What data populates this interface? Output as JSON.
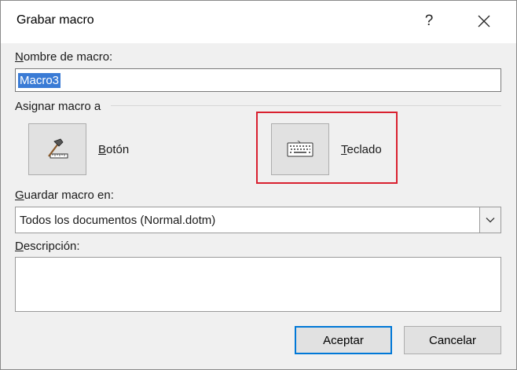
{
  "window": {
    "title": "Grabar macro",
    "help_glyph": "?"
  },
  "macro_name": {
    "label_accel": "N",
    "label_rest": "ombre de macro:",
    "value": "Macro3"
  },
  "assign": {
    "label": "Asignar macro a",
    "button_accel": "B",
    "button_rest": "otón",
    "keyboard_accel": "T",
    "keyboard_rest": "eclado"
  },
  "store_in": {
    "label_accel": "G",
    "label_rest": "uardar macro en:",
    "selected": "Todos los documentos (Normal.dotm)"
  },
  "description": {
    "label_accel": "D",
    "label_rest": "escripción:",
    "value": ""
  },
  "footer": {
    "ok_label": "Aceptar",
    "cancel_label": "Cancelar"
  },
  "colors": {
    "highlight": "#d9202f",
    "selection": "#3a7bd5",
    "default_button_border": "#0078d7"
  }
}
